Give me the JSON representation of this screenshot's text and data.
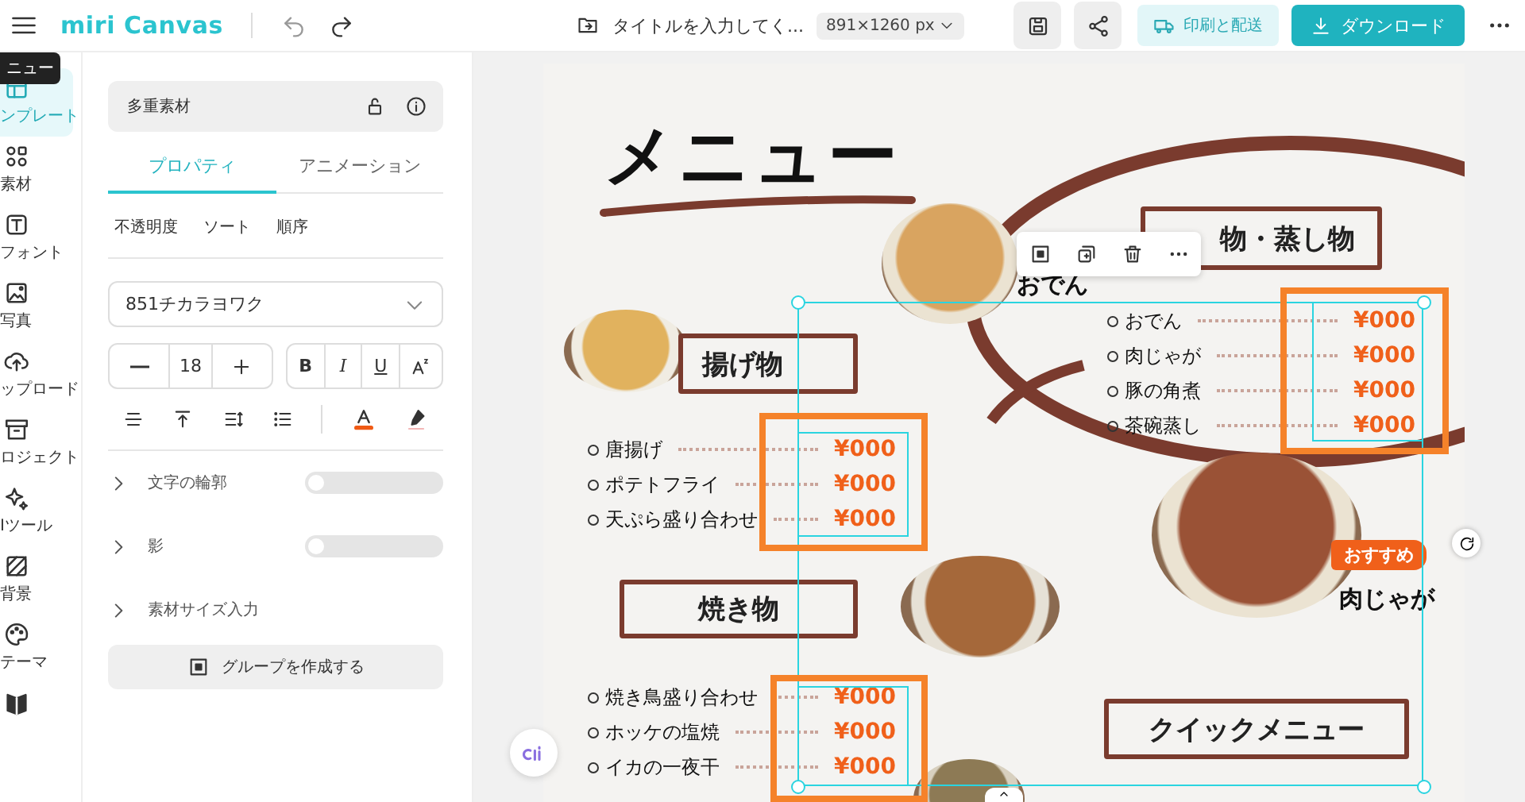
{
  "tooltip": {
    "text": "ニュー"
  },
  "top_bar": {
    "logo": "miri Canvas",
    "title": "タイトルを入力してく...",
    "size": "891×1260 px",
    "print_button": "印刷と配送",
    "download_button": "ダウンロード"
  },
  "rail": [
    {
      "label": "ンプレート",
      "selected": true
    },
    {
      "label": "素材",
      "selected": false
    },
    {
      "label": "フォント",
      "selected": false
    },
    {
      "label": "写真",
      "selected": false
    },
    {
      "label": "ップロード",
      "selected": false
    },
    {
      "label": "ロジェクト",
      "selected": false
    },
    {
      "label": "Iツール",
      "selected": false
    },
    {
      "label": "背景",
      "selected": false
    },
    {
      "label": "テーマ",
      "selected": false
    },
    {
      "selected": false
    }
  ],
  "panel": {
    "element_name": "多重素材",
    "tabs": [
      {
        "label": "プロパティ",
        "selected": true
      },
      {
        "label": "アニメーション",
        "selected": false
      }
    ],
    "sub_tabs": [
      "不透明度",
      "ソート",
      "順序"
    ],
    "font": "851チカラヨワク",
    "font_size": "18",
    "style_buttons": [
      {
        "label": "B",
        "kind": "bold"
      },
      {
        "label": "I",
        "kind": "italic"
      },
      {
        "label": "U",
        "kind": "underline"
      }
    ],
    "sections": [
      {
        "label": "文字の輪郭",
        "kind": "toggle",
        "on": false
      },
      {
        "label": "影",
        "kind": "toggle",
        "on": false
      },
      {
        "label": "素材サイズ入力",
        "kind": "plain"
      }
    ],
    "group_button": "グループを作成する"
  },
  "menu": {
    "title": "メニュー",
    "groups": [
      {
        "heading": "揚げ物",
        "items": [
          {
            "name": "唐揚げ",
            "price": "¥000"
          },
          {
            "name": "ポテトフライ",
            "price": "¥000"
          },
          {
            "name": "天ぷら盛り合わせ",
            "price": "¥000"
          }
        ]
      },
      {
        "heading": "焼き物",
        "items": [
          {
            "name": "焼き鳥盛り合わせ",
            "price": "¥000"
          },
          {
            "name": "ホッケの塩焼",
            "price": "¥000"
          },
          {
            "name": "イカの一夜干",
            "price": "¥000"
          }
        ]
      },
      {
        "heading": "物・蒸し物",
        "items": [
          {
            "name": "おでん",
            "price": "¥000"
          },
          {
            "name": "肉じゃが",
            "price": "¥000"
          },
          {
            "name": "豚の角煮",
            "price": "¥000"
          },
          {
            "name": "茶碗蒸し",
            "price": "¥000"
          }
        ]
      }
    ],
    "dish_label": "おでん",
    "badge": "おすすめ",
    "feature_label": "肉じゃが",
    "quick_heading": "クイックメニュー"
  }
}
